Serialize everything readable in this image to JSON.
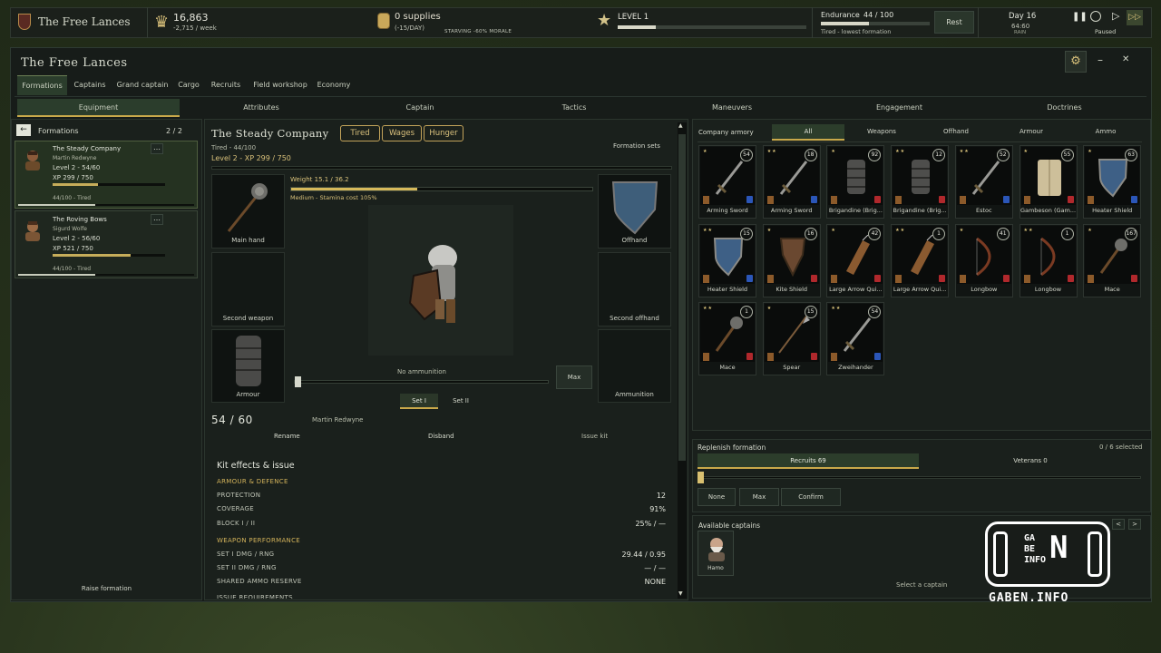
{
  "topbar": {
    "company_name": "The Free Lances",
    "gold": "16,863",
    "gold_rate": "-2,715 / week",
    "supplies": "0 supplies",
    "supplies_rate": "(-15/DAY)",
    "starving": "STARVING -60% MORALE",
    "level": "LEVEL 1",
    "endurance_label": "Endurance",
    "endurance_value": "44 / 100",
    "endurance_status": "Tired - lowest formation",
    "rest_label": "Rest",
    "day": "Day 16",
    "day_sub": "64:60",
    "weather": "RAIN",
    "paused": "Paused",
    "level_progress": 0.2,
    "endurance_progress": 0.44
  },
  "window": {
    "title": "The Free Lances",
    "tabs": [
      {
        "label": "Formations"
      },
      {
        "label": "Captains"
      },
      {
        "label": "Grand captain"
      },
      {
        "label": "Cargo"
      },
      {
        "label": "Recruits"
      },
      {
        "label": "Field workshop"
      },
      {
        "label": "Economy"
      }
    ],
    "subtabs": [
      {
        "label": "Equipment"
      },
      {
        "label": "Attributes"
      },
      {
        "label": "Captain"
      },
      {
        "label": "Tactics"
      },
      {
        "label": "Maneuvers"
      },
      {
        "label": "Engagement"
      },
      {
        "label": "Doctrines"
      }
    ]
  },
  "formations": {
    "header": "Formations",
    "count": "2 / 2",
    "raise": "Raise formation",
    "cards": [
      {
        "name": "The Steady Company",
        "captain": "Martin Redwyne",
        "level": "Level 2 - 54/60",
        "xp": "XP 299 / 750",
        "status": "44/100 - Tired",
        "xp_progress": 0.4,
        "status_progress": 0.44
      },
      {
        "name": "The Roving Bows",
        "captain": "Sigurd Wolfe",
        "level": "Level 2 - 56/60",
        "xp": "XP 521 / 750",
        "status": "44/100 - Tired",
        "xp_progress": 0.69,
        "status_progress": 0.44
      }
    ]
  },
  "company": {
    "name": "The Steady Company",
    "tags": [
      "Tired",
      "Wages",
      "Hunger"
    ],
    "tired_line": "Tired - 44/100",
    "level_line": "Level 2 - XP 299 / 750",
    "formation_sets": "Formation sets",
    "weight": "Weight 15.1 / 36.2",
    "stamina": "Medium - Stamina cost 105%",
    "weight_progress": 0.42,
    "main_hand": "Main hand",
    "offhand": "Offhand",
    "second_weapon": "Second weapon",
    "second_offhand": "Second offhand",
    "armour": "Armour",
    "ammunition": "Ammunition",
    "no_ammo": "No ammunition",
    "max": "Max",
    "set1": "Set I",
    "set2": "Set II",
    "troops": "54 / 60",
    "captain": "Martin Redwyne",
    "rename": "Rename",
    "disband": "Disband",
    "issue_kit": "Issue kit"
  },
  "kit": {
    "title": "Kit effects & issue",
    "armour_header": "ARMOUR & DEFENCE",
    "protection_label": "PROTECTION",
    "protection": "12",
    "coverage_label": "COVERAGE",
    "coverage": "91%",
    "block_label": "BLOCK  I / II",
    "block": "25% / —",
    "weapon_header": "WEAPON PERFORMANCE",
    "set1_label": "SET I  DMG / RNG",
    "set1": "29.44  /  0.95",
    "set2_label": "SET II  DMG / RNG",
    "set2": "— / —",
    "ammo_label": "SHARED AMMO RESERVE",
    "ammo": "NONE",
    "issue_header": "ISSUE REQUIREMENTS"
  },
  "armory": {
    "title": "Company armory",
    "filters": [
      {
        "label": "All"
      },
      {
        "label": "Weapons"
      },
      {
        "label": "Offhand"
      },
      {
        "label": "Armour"
      },
      {
        "label": "Ammo"
      }
    ],
    "items": [
      {
        "name": "Arming Sword",
        "count": "54",
        "stars": "★",
        "type": "sword"
      },
      {
        "name": "Arming Sword",
        "count": "18",
        "stars": "★★",
        "type": "sword"
      },
      {
        "name": "Brigandine (Brig...",
        "count": "92",
        "stars": "★",
        "type": "armor"
      },
      {
        "name": "Brigandine (Brig...",
        "count": "12",
        "stars": "★★",
        "type": "armor"
      },
      {
        "name": "Estoc",
        "count": "52",
        "stars": "★★",
        "type": "sword"
      },
      {
        "name": "Gambeson (Gam...",
        "count": "55",
        "stars": "★",
        "type": "gambeson"
      },
      {
        "name": "Heater Shield",
        "count": "63",
        "stars": "★",
        "type": "shield"
      },
      {
        "name": "Heater Shield",
        "count": "15",
        "stars": "★★",
        "type": "shield"
      },
      {
        "name": "Kite Shield",
        "count": "16",
        "stars": "★",
        "type": "kite"
      },
      {
        "name": "Large Arrow Qui...",
        "count": "42",
        "stars": "★",
        "type": "quiver"
      },
      {
        "name": "Large Arrow Qui...",
        "count": "1",
        "stars": "★★",
        "type": "quiver"
      },
      {
        "name": "Longbow",
        "count": "41",
        "stars": "★",
        "type": "bow"
      },
      {
        "name": "Longbow",
        "count": "1",
        "stars": "★★",
        "type": "bow"
      },
      {
        "name": "Mace",
        "count": "167",
        "stars": "★",
        "type": "mace"
      },
      {
        "name": "Mace",
        "count": "1",
        "stars": "★★",
        "type": "mace"
      },
      {
        "name": "Spear",
        "count": "15",
        "stars": "★",
        "type": "spear"
      },
      {
        "name": "Zweihander",
        "count": "54",
        "stars": "★★",
        "type": "sword"
      }
    ]
  },
  "replenish": {
    "title": "Replenish formation",
    "selected": "0 / 6 selected",
    "recruits": "Recruits 69",
    "veterans": "Veterans 0",
    "none": "None",
    "max": "Max",
    "confirm": "Confirm"
  },
  "captains": {
    "title": "Available captains",
    "captain_name": "Hamo",
    "select": "Select a captain"
  },
  "watermark": {
    "text": "GABEN.INFO",
    "logo_line1": "GA",
    "logo_line2": "BE",
    "logo_line3": "INFO",
    "logo_big": "N"
  }
}
